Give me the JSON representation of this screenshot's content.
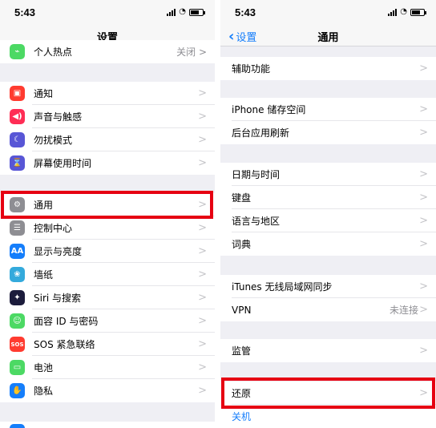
{
  "left": {
    "status": {
      "time": "5:43"
    },
    "title": "设置",
    "rows": [
      {
        "label": "个人热点",
        "value": "关闭 >",
        "icon": "hotspot-icon",
        "color": "#4cd964"
      },
      {
        "label": "通知",
        "icon": "notifications-icon",
        "color": "#ff3b30"
      },
      {
        "label": "声音与触感",
        "icon": "sound-icon",
        "color": "#ff2d55"
      },
      {
        "label": "勿扰模式",
        "icon": "moon-icon",
        "color": "#5856d6"
      },
      {
        "label": "屏幕使用时间",
        "icon": "hourglass-icon",
        "color": "#5856d6"
      },
      {
        "label": "通用",
        "icon": "gear-icon",
        "color": "#8e8e93"
      },
      {
        "label": "控制中心",
        "icon": "control-center-icon",
        "color": "#8e8e93"
      },
      {
        "label": "显示与亮度",
        "icon": "display-icon",
        "color": "#157efb",
        "glyph": "AA"
      },
      {
        "label": "墙纸",
        "icon": "wallpaper-icon",
        "color": "#34aadc"
      },
      {
        "label": "Siri 与搜索",
        "icon": "siri-icon",
        "color": "#1c1c3c"
      },
      {
        "label": "面容 ID 与密码",
        "icon": "face-id-icon",
        "color": "#4cd964"
      },
      {
        "label": "SOS 紧急联络",
        "icon": "sos-icon",
        "color": "#ff3b30",
        "glyph": "SOS"
      },
      {
        "label": "电池",
        "icon": "battery-icon",
        "color": "#4cd964"
      },
      {
        "label": "隐私",
        "icon": "hand-icon",
        "color": "#157efb"
      }
    ]
  },
  "right": {
    "status": {
      "time": "5:43"
    },
    "back_label": "设置",
    "title": "通用",
    "rows": [
      {
        "label": "辅助功能"
      },
      {
        "label": "iPhone 储存空间"
      },
      {
        "label": "后台应用刷新"
      },
      {
        "label": "日期与时间"
      },
      {
        "label": "键盘"
      },
      {
        "label": "语言与地区"
      },
      {
        "label": "词典"
      },
      {
        "label": "iTunes 无线局域网同步"
      },
      {
        "label": "VPN",
        "value": "未连接"
      },
      {
        "label": "监管"
      },
      {
        "label": "还原"
      },
      {
        "label": "关机"
      }
    ]
  },
  "colors": {
    "accent": "#157efb",
    "highlight": "#e60012"
  }
}
